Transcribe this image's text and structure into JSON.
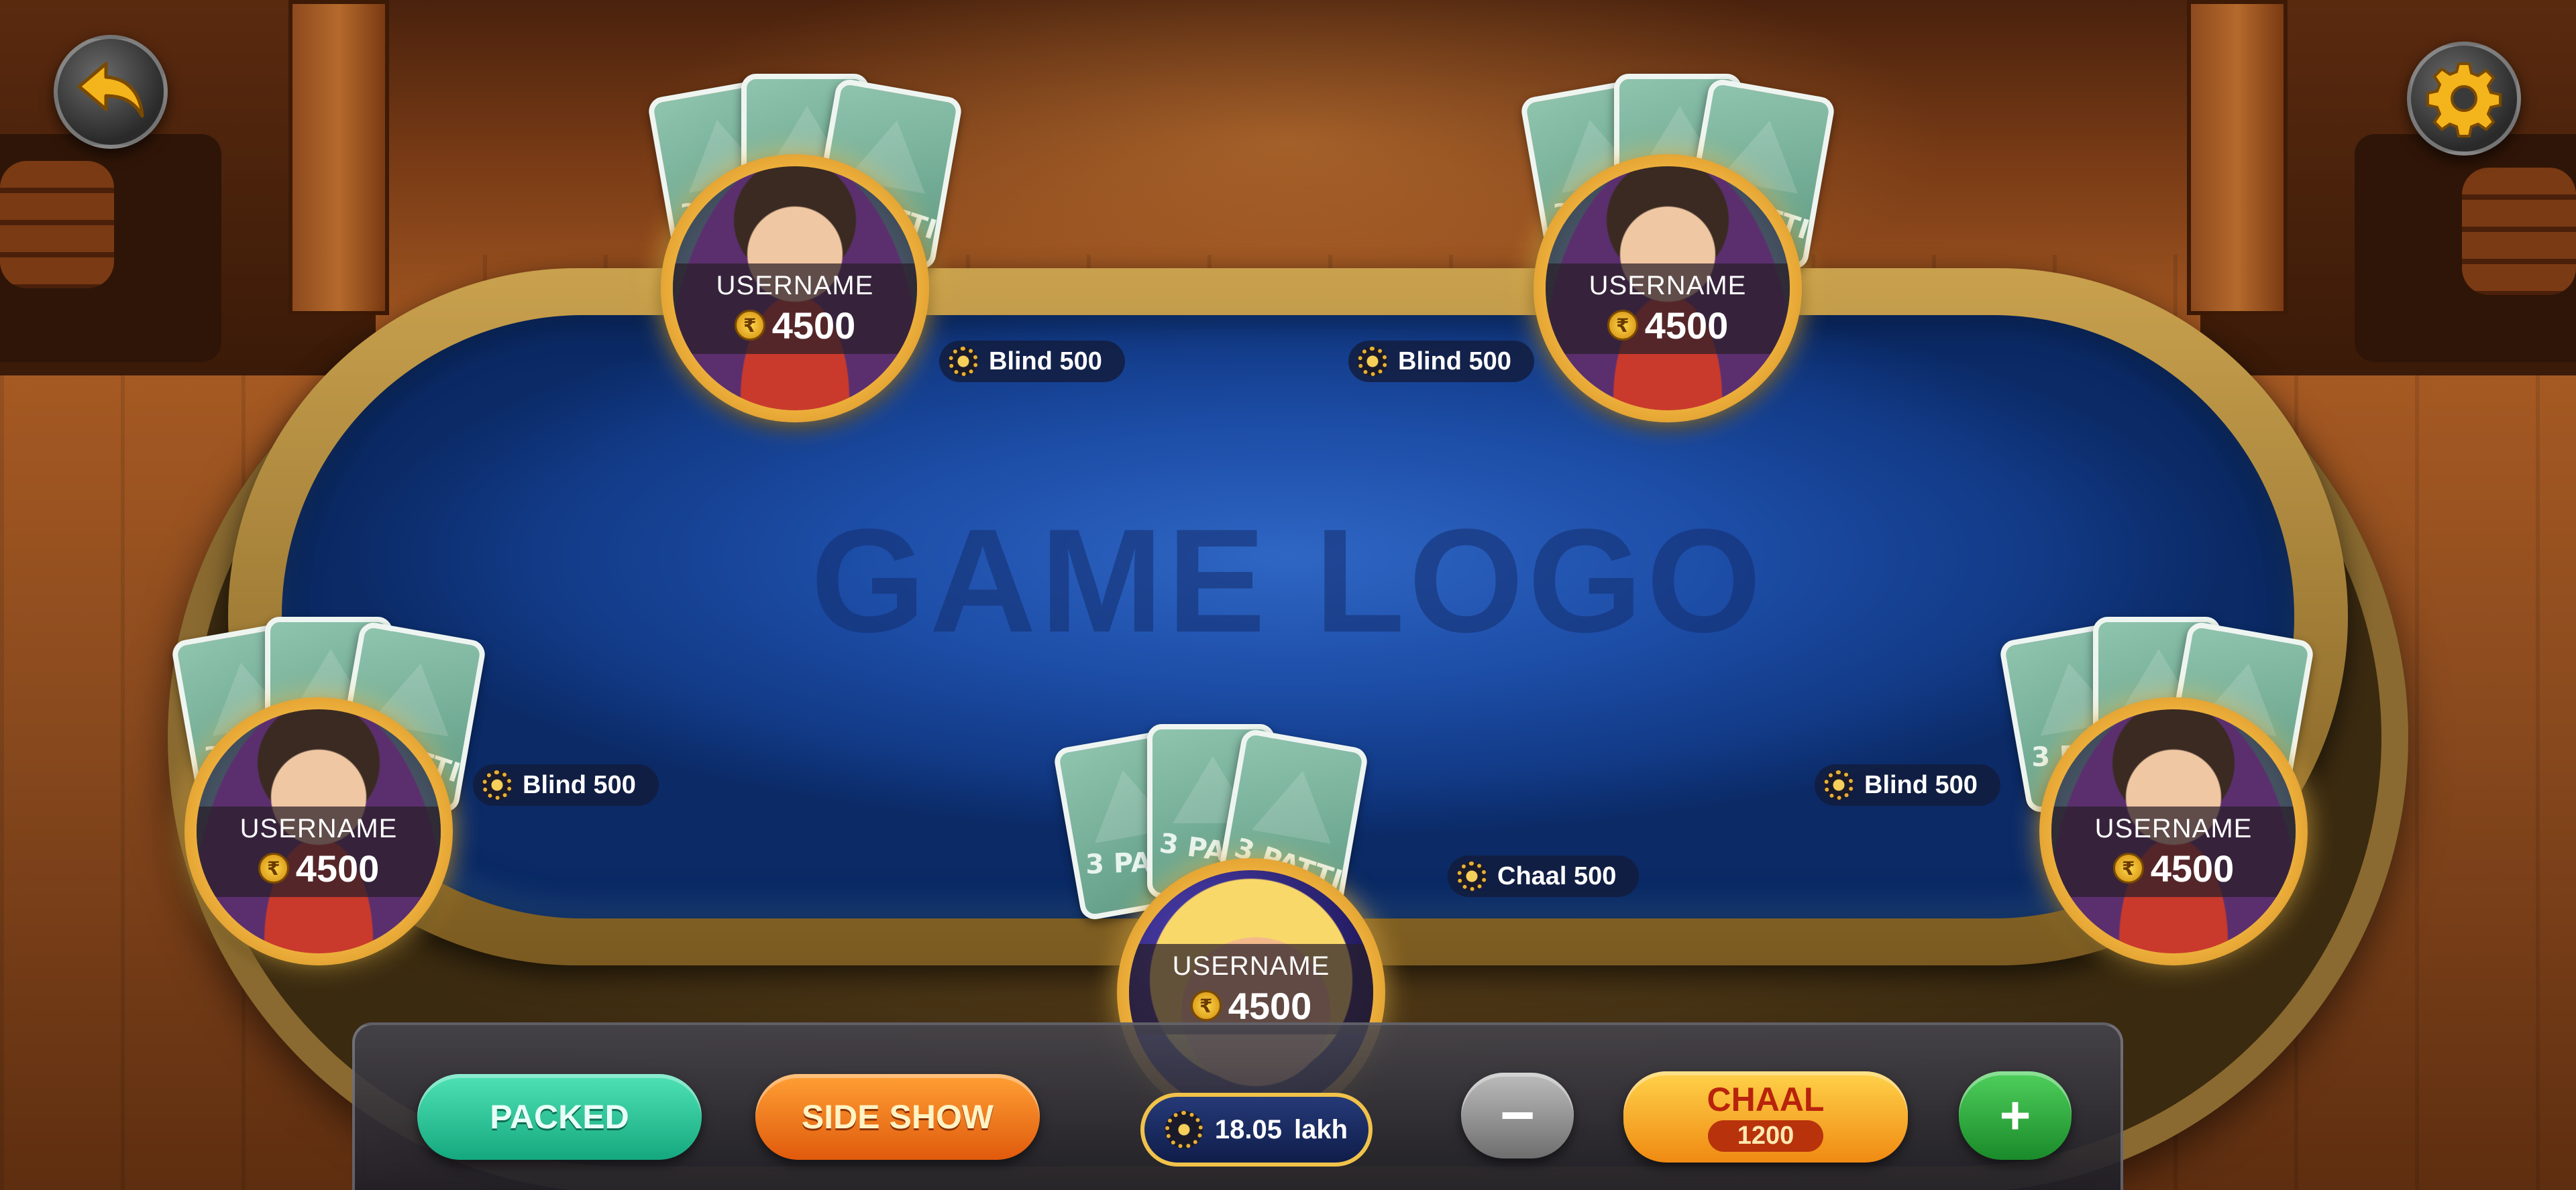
{
  "table": {
    "logo_text": "GAME LOGO"
  },
  "controls": {
    "back_icon": "back-arrow-icon",
    "settings_icon": "gear-icon"
  },
  "card_back_text": "3 PATTI",
  "players": [
    {
      "seat": "top-left",
      "username": "USERNAME",
      "balance": "4500",
      "currency_icon": "rupee-icon"
    },
    {
      "seat": "top-right",
      "username": "USERNAME",
      "balance": "4500",
      "currency_icon": "rupee-icon"
    },
    {
      "seat": "middle-left",
      "username": "USERNAME",
      "balance": "4500",
      "currency_icon": "rupee-icon"
    },
    {
      "seat": "middle-right",
      "username": "USERNAME",
      "balance": "4500",
      "currency_icon": "rupee-icon"
    },
    {
      "seat": "bottom-center",
      "username": "USERNAME",
      "balance": "4500",
      "currency_icon": "rupee-icon"
    }
  ],
  "actions": [
    {
      "label": "Blind 500"
    },
    {
      "label": "Blind 500"
    },
    {
      "label": "Blind 500"
    },
    {
      "label": "Blind 500"
    },
    {
      "label": "Chaal 500"
    }
  ],
  "pot": {
    "amount": "18.05",
    "unit": "lakh"
  },
  "buttons": {
    "packed": "PACKED",
    "side_show": "SIDE SHOW",
    "minus": "−",
    "chaal_label": "CHAAL",
    "chaal_amount": "1200",
    "plus": "+"
  },
  "colors": {
    "felt": "#1d4ea8",
    "gold": "#f2b540",
    "packed": "#15a87e",
    "side_show": "#e05a0c",
    "chaal": "#f08a12",
    "plus": "#1a8a2a"
  }
}
